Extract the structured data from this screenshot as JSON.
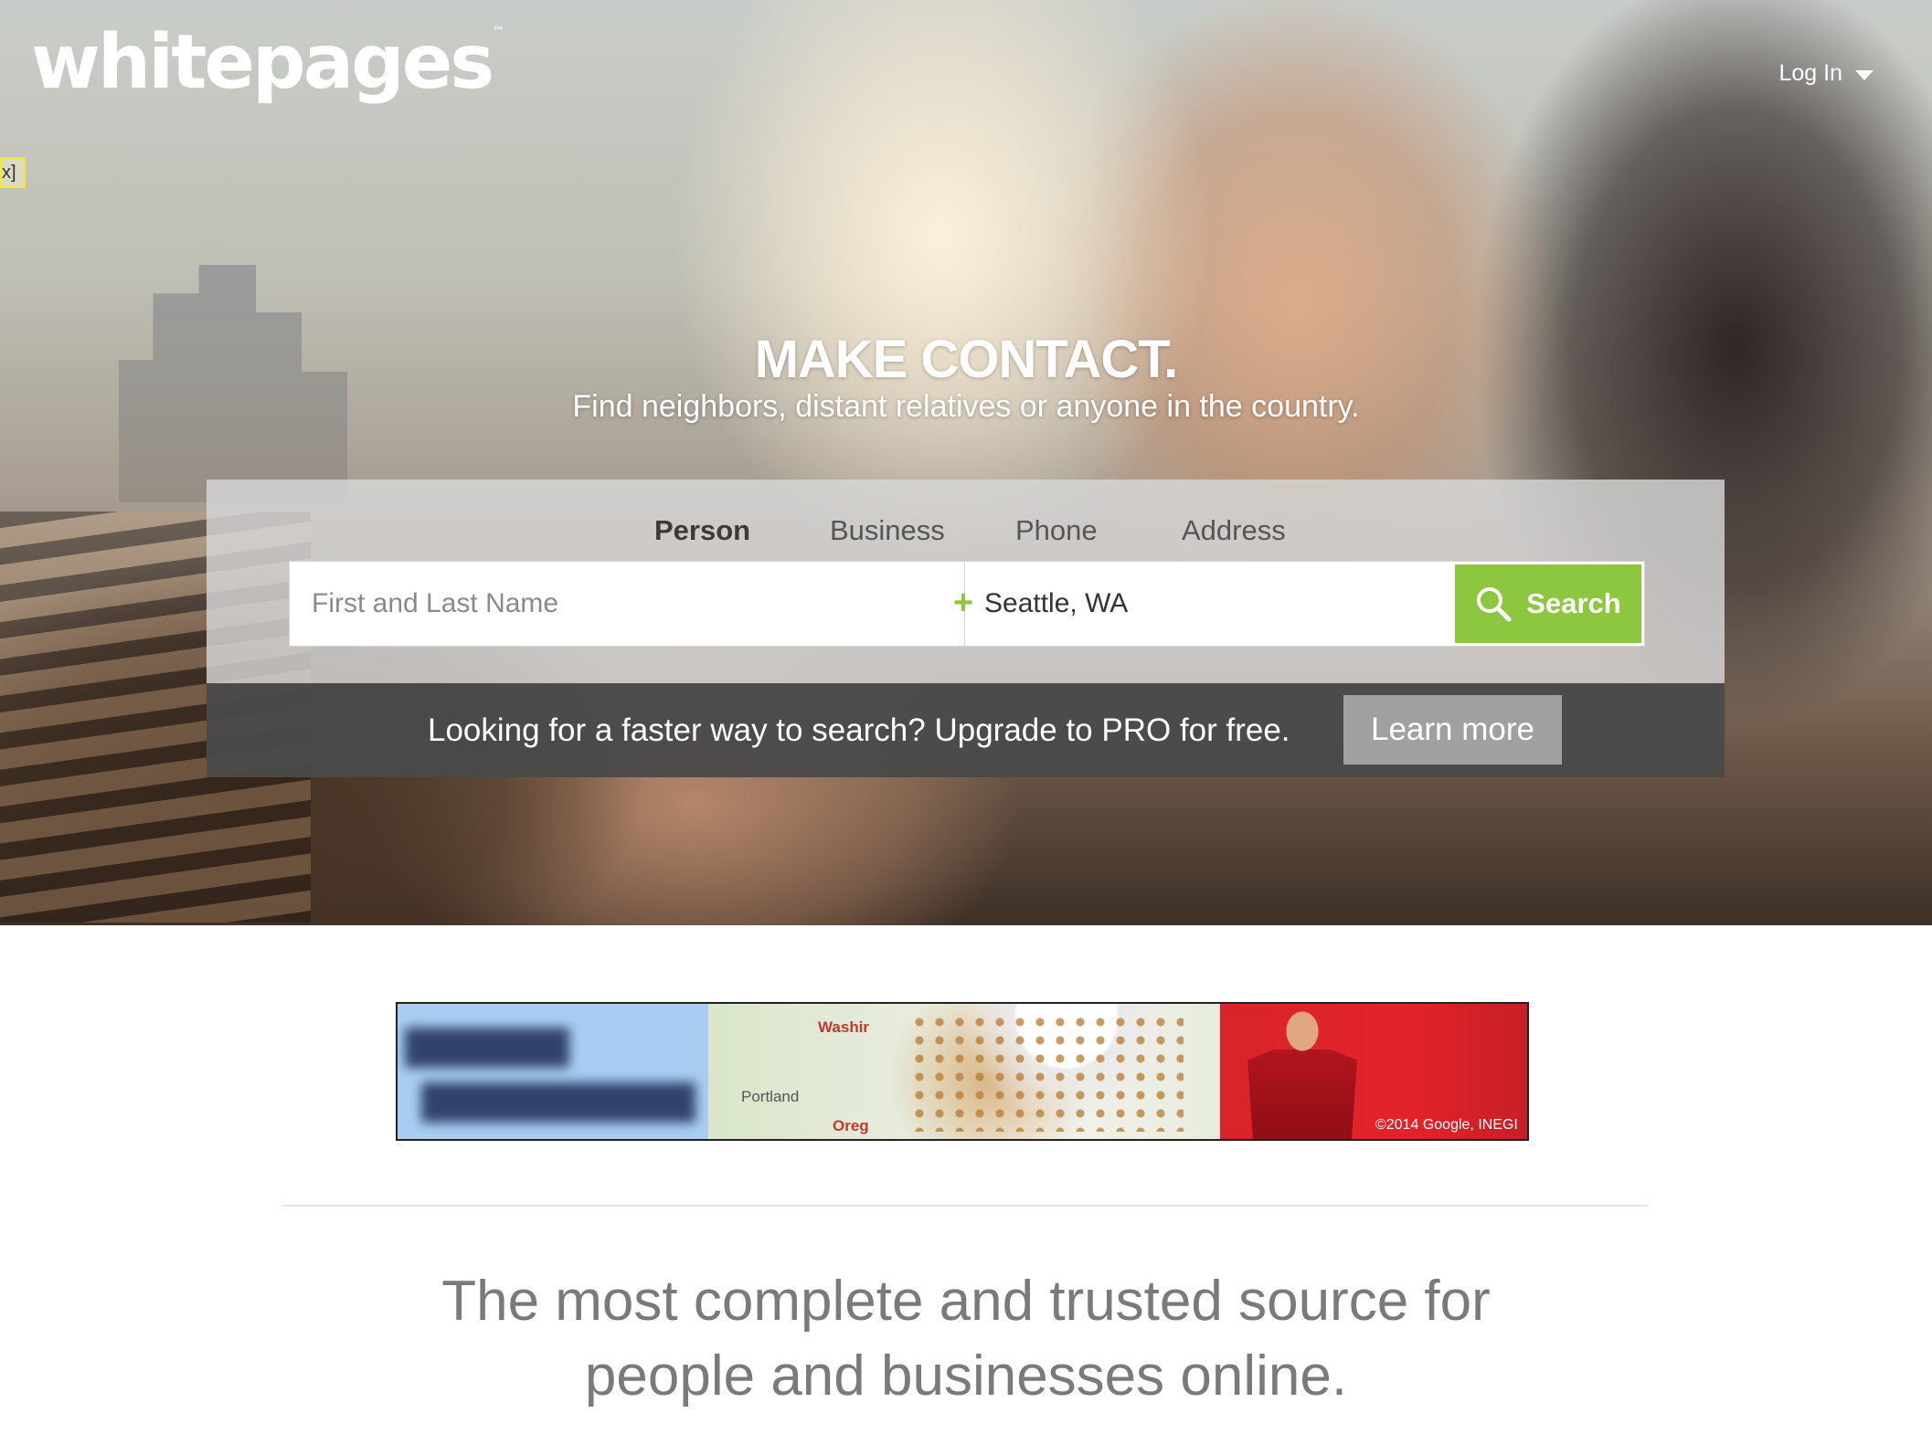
{
  "header": {
    "logo_text": "whitepages",
    "logo_tm": "™",
    "login_label": "Log In",
    "tab_marker": "x]"
  },
  "hero": {
    "headline": "MAKE CONTACT.",
    "subheadline": "Find neighbors, distant relatives or anyone in the country."
  },
  "search": {
    "tabs": [
      {
        "label": "Person",
        "active": true
      },
      {
        "label": "Business",
        "active": false
      },
      {
        "label": "Phone",
        "active": false
      },
      {
        "label": "Address",
        "active": false
      }
    ],
    "name_placeholder": "First and Last Name",
    "location_value": "Seattle, WA",
    "plus_glyph": "+",
    "button_label": "Search",
    "accent_color": "#8dc63f"
  },
  "pro_bar": {
    "text": "Looking for a faster way to search? Upgrade to PRO for free.",
    "button_label": "Learn more"
  },
  "ad": {
    "map_labels": [
      "Washir",
      "Portland",
      "Oreg"
    ],
    "copyright": "©2014 Google, INEGI"
  },
  "tagline": {
    "line1": "The most complete and trusted source for",
    "line2": "people and businesses online."
  },
  "icons": {
    "search": "search-icon",
    "caret": "chevron-down-icon",
    "plus": "plus-icon"
  }
}
